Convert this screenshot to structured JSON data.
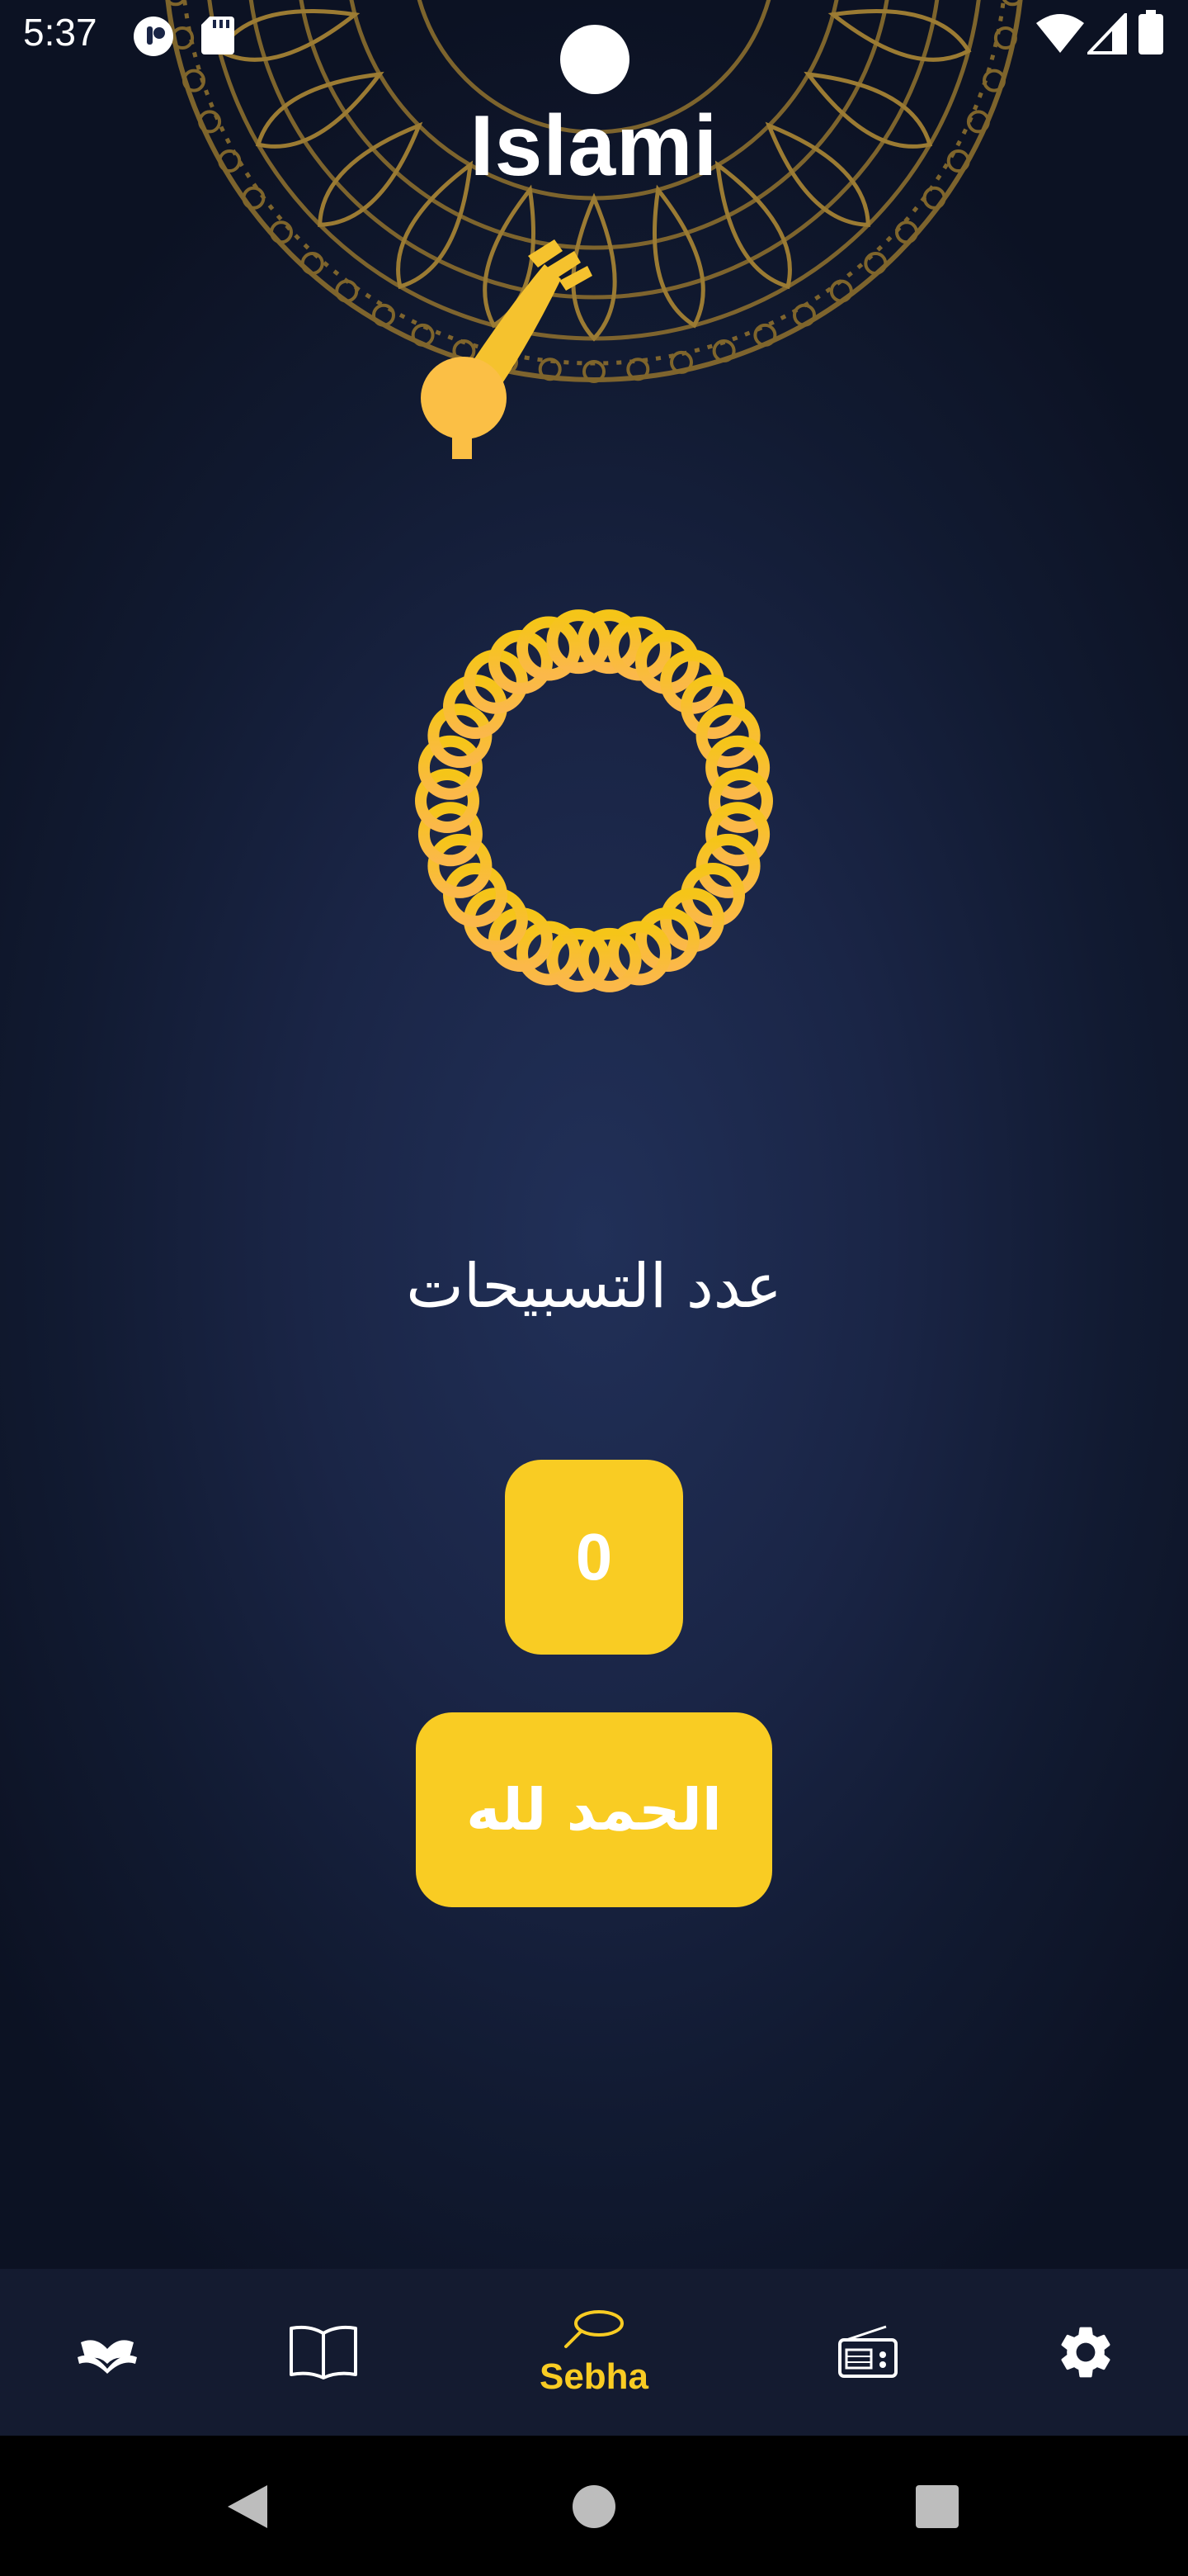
{
  "status_bar": {
    "time": "5:37"
  },
  "app": {
    "title": "Islami"
  },
  "sebha": {
    "count_heading": "عدد التسبيحات",
    "counter_value": "0",
    "dhikr_text": "الحمد لله"
  },
  "bottom_nav": {
    "items": [
      {
        "icon": "quran-icon",
        "label": "",
        "active": false
      },
      {
        "icon": "book-icon",
        "label": "",
        "active": false
      },
      {
        "icon": "sebha-icon",
        "label": "Sebha",
        "active": true
      },
      {
        "icon": "radio-icon",
        "label": "",
        "active": false
      },
      {
        "icon": "gear-icon",
        "label": "",
        "active": false
      }
    ]
  },
  "colors": {
    "accent": "#f9cc23",
    "background": "#1a2546",
    "nav_background": "#141b30",
    "text": "#ffffff"
  }
}
